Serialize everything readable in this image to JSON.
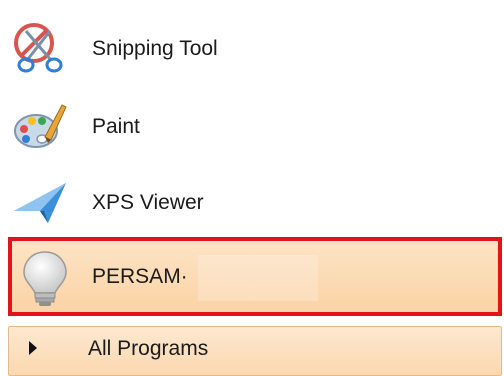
{
  "start_menu": {
    "programs": [
      {
        "label": "Snipping Tool",
        "icon": "snipping-tool-icon"
      },
      {
        "label": "Paint",
        "icon": "paint-palette-icon"
      },
      {
        "label": "XPS Viewer",
        "icon": "xps-viewer-icon"
      },
      {
        "label": "PERSAM·",
        "icon": "lightbulb-icon",
        "selected": true
      }
    ],
    "all_programs": {
      "label": "All Programs",
      "icon": "triangle-right-icon"
    },
    "colors": {
      "selection_border": "#e3131b",
      "selection_fill": "#fbd3a6",
      "text": "#1b1b1b"
    }
  }
}
